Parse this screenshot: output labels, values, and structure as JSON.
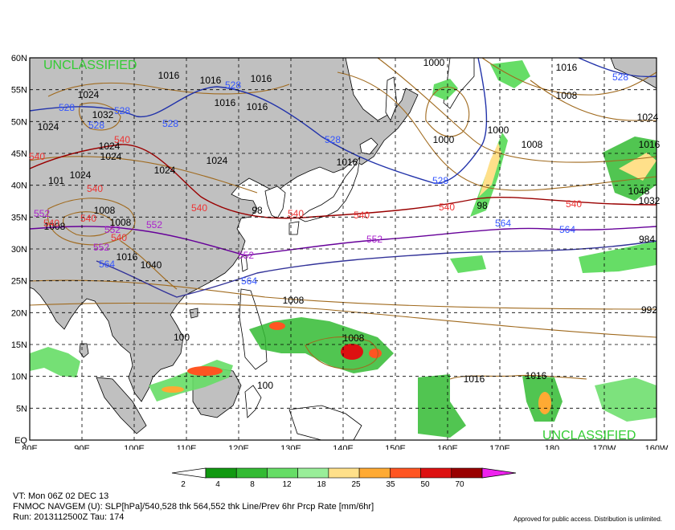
{
  "map": {
    "unclassified_top": "UNCLASSIFIED",
    "unclassified_bottom": "UNCLASSIFIED",
    "lat_labels": [
      "60N",
      "55N",
      "50N",
      "45N",
      "40N",
      "35N",
      "30N",
      "25N",
      "20N",
      "15N",
      "10N",
      "5N",
      "EQ"
    ],
    "lon_labels": [
      "80E",
      "90E",
      "100E",
      "110E",
      "120E",
      "130E",
      "140E",
      "150E",
      "160E",
      "170E",
      "180",
      "170W",
      "160W"
    ],
    "pressure_labels": [
      {
        "text": "1016",
        "color": "#000000"
      },
      {
        "text": "1016",
        "color": "#000000"
      },
      {
        "text": "1016",
        "color": "#000000"
      },
      {
        "text": "1016",
        "color": "#000000"
      },
      {
        "text": "1016",
        "color": "#000000"
      },
      {
        "text": "1024",
        "color": "#000000"
      },
      {
        "text": "1032",
        "color": "#000000"
      },
      {
        "text": "1024",
        "color": "#000000"
      },
      {
        "text": "1024",
        "color": "#000000"
      },
      {
        "text": "1024",
        "color": "#000000"
      },
      {
        "text": "1024",
        "color": "#000000"
      },
      {
        "text": "1024",
        "color": "#000000"
      },
      {
        "text": "1024",
        "color": "#000000"
      },
      {
        "text": "1016",
        "color": "#000000"
      },
      {
        "text": "1000",
        "color": "#000000"
      },
      {
        "text": "1000",
        "color": "#000000"
      },
      {
        "text": "1000",
        "color": "#000000"
      },
      {
        "text": "1008",
        "color": "#000000"
      },
      {
        "text": "1016",
        "color": "#000000"
      },
      {
        "text": "1008",
        "color": "#000000"
      },
      {
        "text": "1008",
        "color": "#000000"
      },
      {
        "text": "1016",
        "color": "#000000"
      },
      {
        "text": "1016",
        "color": "#000000"
      },
      {
        "text": "1008",
        "color": "#000000"
      },
      {
        "text": "1008",
        "color": "#000000"
      },
      {
        "text": "1008",
        "color": "#000000"
      },
      {
        "text": "1008",
        "color": "#000000"
      },
      {
        "text": "1016",
        "color": "#000000"
      },
      {
        "text": "1040",
        "color": "#000000"
      },
      {
        "text": "1048",
        "color": "#000000"
      },
      {
        "text": "1032",
        "color": "#000000"
      },
      {
        "text": "1024",
        "color": "#000000"
      },
      {
        "text": "1016",
        "color": "#000000"
      },
      {
        "text": "984",
        "color": "#000000"
      },
      {
        "text": "992",
        "color": "#000000"
      },
      {
        "text": "98",
        "color": "#000000"
      },
      {
        "text": "98",
        "color": "#000000"
      },
      {
        "text": "100",
        "color": "#000000"
      },
      {
        "text": "101",
        "color": "#000000"
      },
      {
        "text": "100",
        "color": "#000000"
      }
    ],
    "thickness_labels": [
      {
        "text": "528",
        "color": "#3355ff"
      },
      {
        "text": "528",
        "color": "#3355ff"
      },
      {
        "text": "528",
        "color": "#3355ff"
      },
      {
        "text": "528",
        "color": "#3355ff"
      },
      {
        "text": "528",
        "color": "#3355ff"
      },
      {
        "text": "528",
        "color": "#3355ff"
      },
      {
        "text": "528",
        "color": "#3355ff"
      },
      {
        "text": "528",
        "color": "#3355ff"
      },
      {
        "text": "540",
        "color": "#ee3333"
      },
      {
        "text": "540",
        "color": "#ee3333"
      },
      {
        "text": "540",
        "color": "#ee3333"
      },
      {
        "text": "540",
        "color": "#ee3333"
      },
      {
        "text": "540",
        "color": "#ee3333"
      },
      {
        "text": "540",
        "color": "#ee3333"
      },
      {
        "text": "540",
        "color": "#ee3333"
      },
      {
        "text": "540",
        "color": "#ee3333"
      },
      {
        "text": "540",
        "color": "#ee3333"
      },
      {
        "text": "540",
        "color": "#ee3333"
      },
      {
        "text": "540",
        "color": "#ee3333"
      },
      {
        "text": "552",
        "color": "#aa22cc"
      },
      {
        "text": "552",
        "color": "#aa22cc"
      },
      {
        "text": "552",
        "color": "#aa22cc"
      },
      {
        "text": "552",
        "color": "#aa22cc"
      },
      {
        "text": "552",
        "color": "#aa22cc"
      },
      {
        "text": "552",
        "color": "#aa22cc"
      },
      {
        "text": "564",
        "color": "#3355ff"
      },
      {
        "text": "564",
        "color": "#3355ff"
      },
      {
        "text": "564",
        "color": "#3355ff"
      },
      {
        "text": "564",
        "color": "#3355ff"
      }
    ],
    "colors": {
      "land": "#c0c0c0",
      "ocean": "#ffffff",
      "isobar": "#a06a1e",
      "thk528": "#2233aa",
      "thk540": "#990000",
      "thk552": "#660099",
      "thk564": "#333399"
    }
  },
  "colorbar": {
    "ticks": [
      "2",
      "4",
      "8",
      "12",
      "18",
      "25",
      "35",
      "50",
      "70"
    ],
    "colors": [
      "#119911",
      "#33bb33",
      "#66dd66",
      "#99ee99",
      "#ffe08a",
      "#ffaa33",
      "#ff5522",
      "#dd1111",
      "#990000",
      "#770011",
      "#ee22ee"
    ]
  },
  "footer": {
    "line1": "VT: Mon 06Z 02 DEC 13",
    "line2": "FNMOC NAVGEM (U): SLP[hPa]/540,528 thk 564,552 thk Line/Prev 6hr Prcp Rate [mm/6hr]",
    "line3": "Run: 2013112500Z Tau: 174",
    "approval": "Approved for public access. Distribution is unlimited."
  }
}
